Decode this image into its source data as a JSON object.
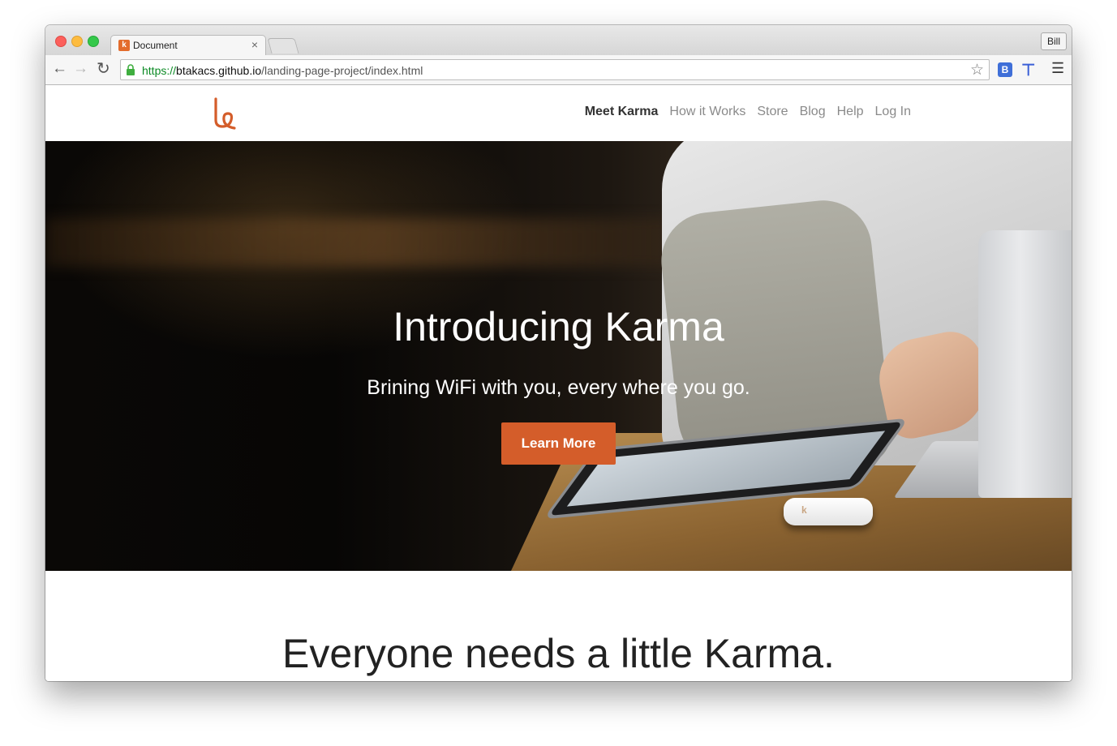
{
  "browser": {
    "tab_title": "Document",
    "tab_close": "×",
    "profile_label": "Bill",
    "url_scheme": "https://",
    "url_host": "btakacs.github.io",
    "url_path": "/landing-page-project/index.html",
    "extension_b_label": "B",
    "icons": [
      "back-icon",
      "forward-icon",
      "reload-icon",
      "lock-icon",
      "star-icon",
      "extension-icon",
      "menu-icon"
    ]
  },
  "site": {
    "nav": [
      "Meet Karma",
      "How it Works",
      "Store",
      "Blog",
      "Help",
      "Log In"
    ],
    "active_nav": "Meet Karma",
    "hero_title": "Introducing Karma",
    "hero_subtitle": "Brining WiFi with you, every where you go.",
    "cta_label": "Learn More",
    "section_title": "Everyone needs a little Karma.",
    "accent_color": "#d45d2a"
  }
}
